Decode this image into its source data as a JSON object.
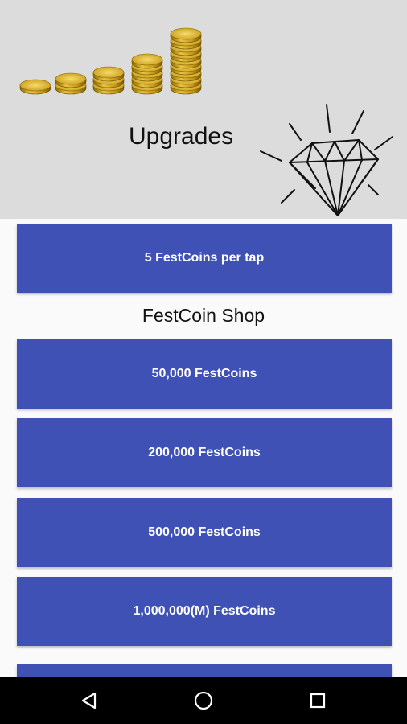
{
  "header": {
    "title": "Upgrades",
    "background_color": "#dcdcdc",
    "art_left": "coins-stack-icon",
    "art_right": "diamond-icon"
  },
  "upgrade_button": {
    "label": "5 FestCoins per tap"
  },
  "shop": {
    "title": "FestCoin Shop",
    "items": [
      {
        "label": "50,000 FestCoins"
      },
      {
        "label": "200,000 FestCoins"
      },
      {
        "label": "500,000 FestCoins"
      },
      {
        "label": "1,000,000(M) FestCoins"
      }
    ]
  },
  "colors": {
    "button": "#3f51b5",
    "button_text": "#ffffff",
    "navbar": "#000000"
  },
  "navbar": {
    "buttons": [
      "back-icon",
      "home-icon",
      "recents-icon"
    ]
  }
}
